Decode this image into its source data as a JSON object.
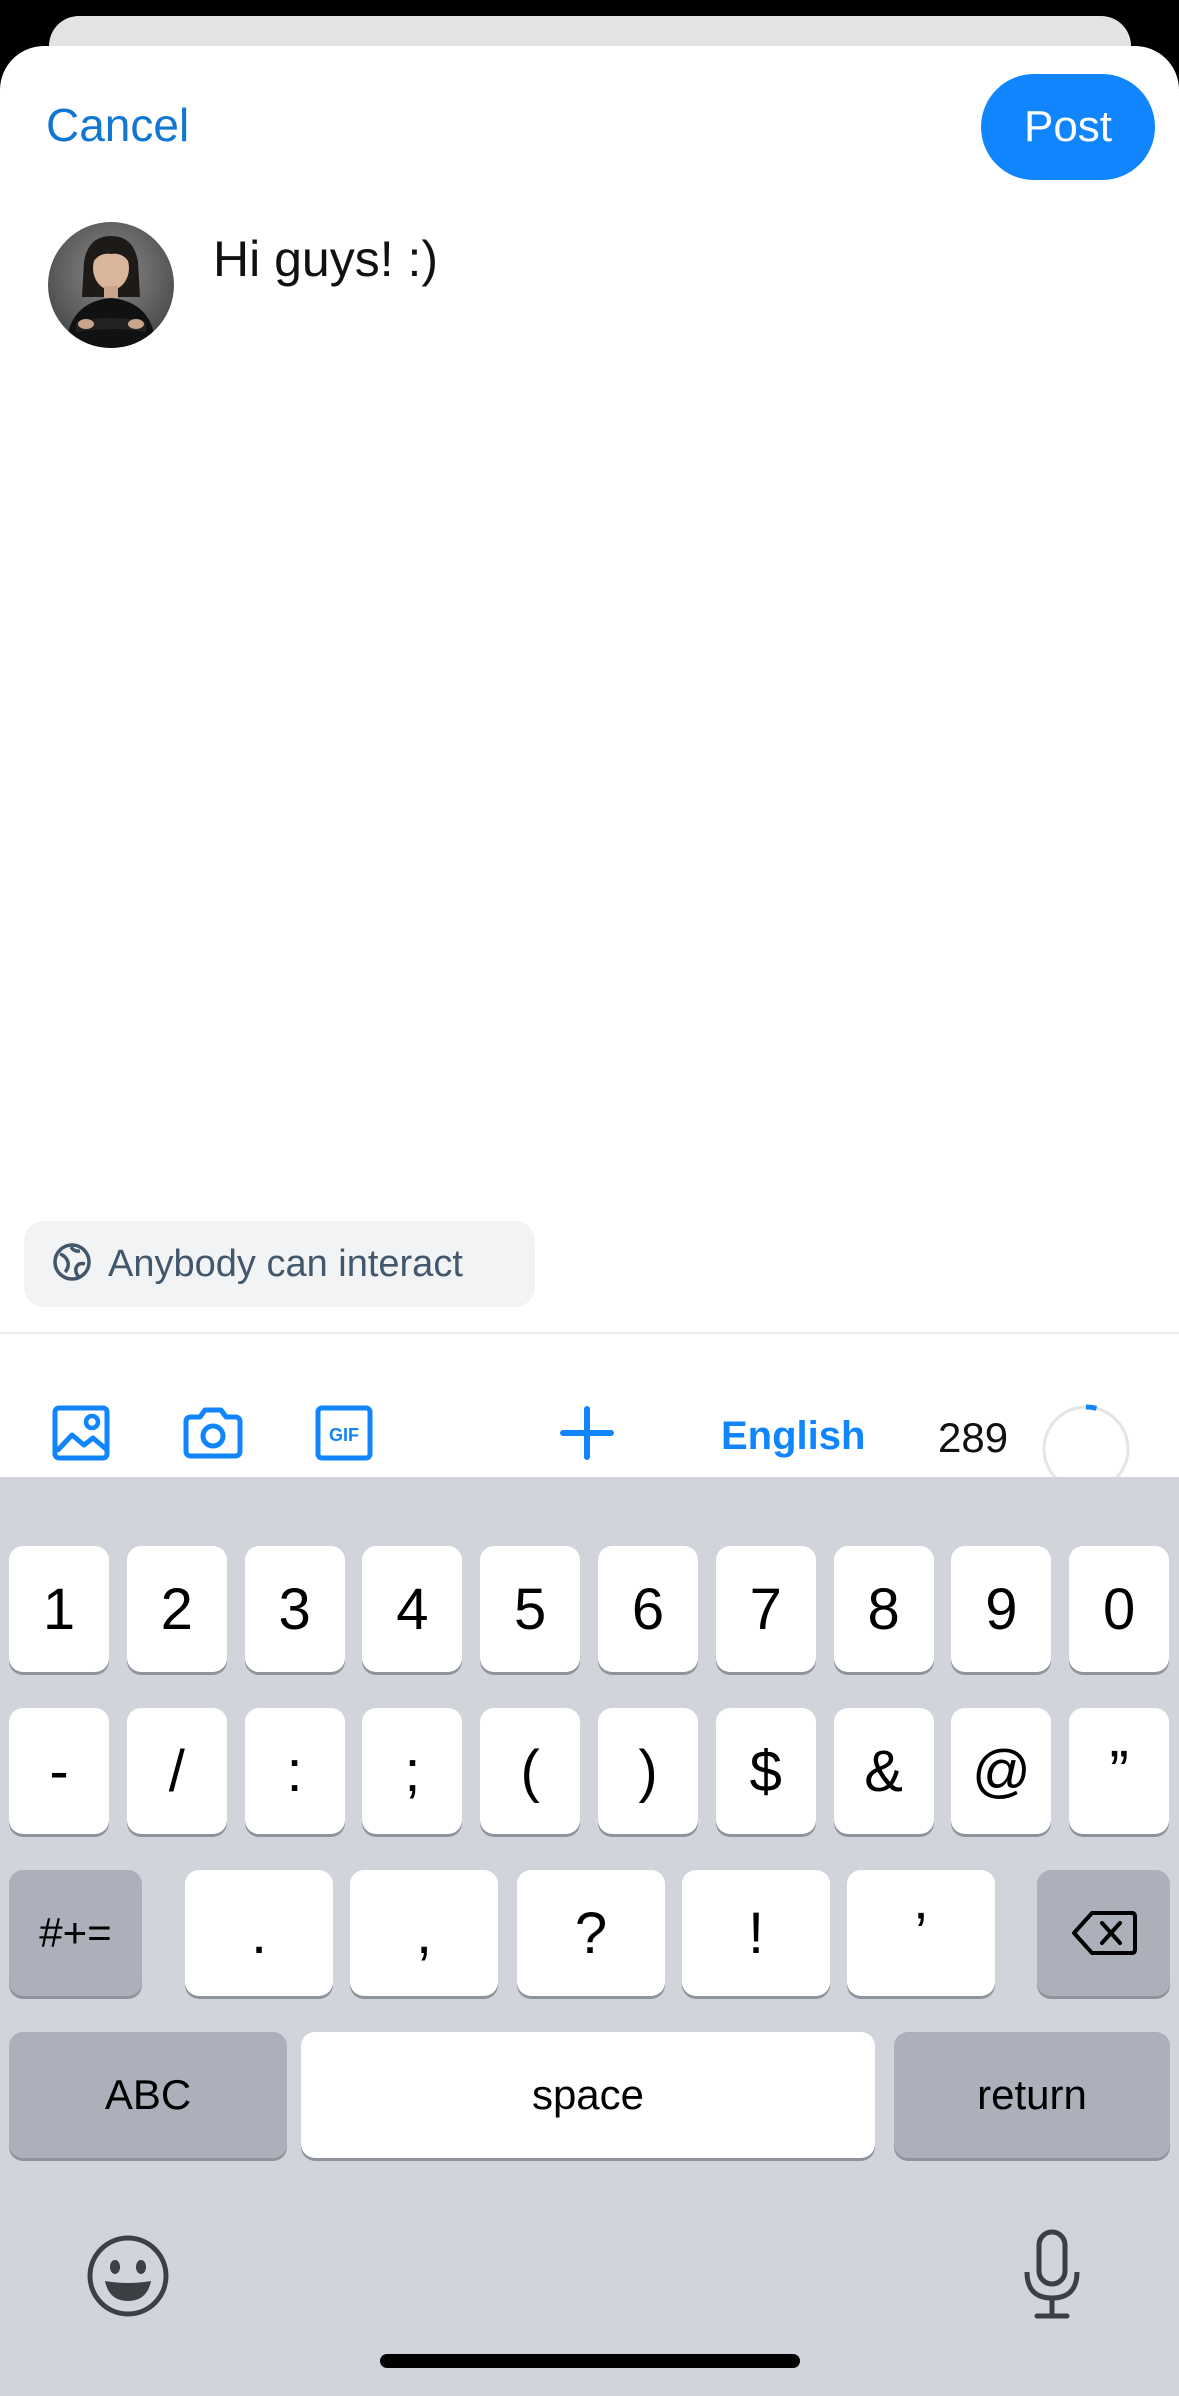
{
  "header": {
    "cancel_label": "Cancel",
    "post_label": "Post"
  },
  "composer": {
    "text": "Hi guys! :)"
  },
  "interaction": {
    "label": "Anybody can interact",
    "icon": "globe-icon"
  },
  "toolbar": {
    "icons": [
      "image-icon",
      "camera-icon",
      "gif-icon",
      "plus-icon"
    ],
    "gif_label": "GIF",
    "language": "English",
    "char_count": "289",
    "char_progress": 0.04
  },
  "keyboard": {
    "row1": [
      "1",
      "2",
      "3",
      "4",
      "5",
      "6",
      "7",
      "8",
      "9",
      "0"
    ],
    "row2": [
      "-",
      "/",
      ":",
      ";",
      "(",
      ")",
      "$",
      "&",
      "@",
      "”"
    ],
    "row3_left": "#+=",
    "row3": [
      ".",
      ",",
      "?",
      "!",
      "’"
    ],
    "row4_left": "ABC",
    "space": "space",
    "return": "return"
  },
  "colors": {
    "accent": "#1185fe",
    "link": "#1177d2",
    "keyboard_bg": "#d1d4db"
  }
}
